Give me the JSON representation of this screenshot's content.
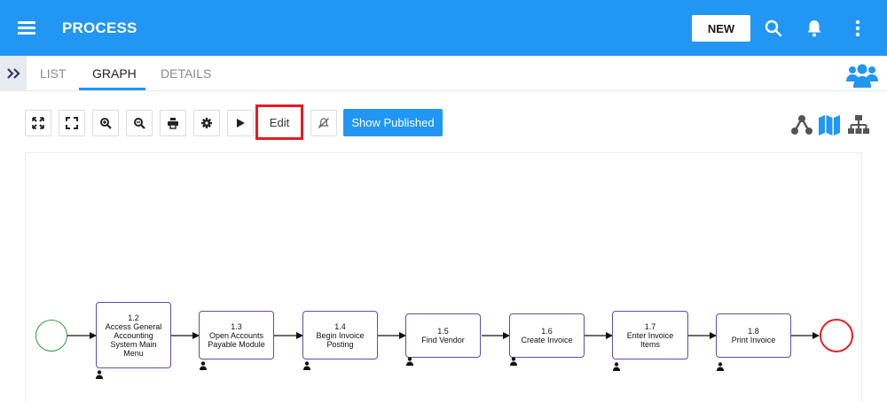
{
  "header": {
    "title": "PROCESS",
    "new_label": "NEW",
    "icons": [
      "menu-icon",
      "search-icon",
      "bell-icon",
      "more-vertical-icon"
    ],
    "bar_color": "#2196f3"
  },
  "tabs": [
    {
      "label": "LIST",
      "active": false
    },
    {
      "label": "GRAPH",
      "active": true
    },
    {
      "label": "DETAILS",
      "active": false
    }
  ],
  "toolbar": {
    "tools": [
      "fit-screen-icon",
      "fullscreen-icon",
      "zoom-in-icon",
      "zoom-out-icon",
      "print-icon",
      "gear-icon",
      "play-icon"
    ],
    "edit_label": "Edit",
    "show_published_label": "Show Published",
    "highlight_color": "#e51c23",
    "view_icons": [
      "flow-view-icon",
      "map-view-icon",
      "hierarchy-view-icon"
    ]
  },
  "graph": {
    "start_color": "#2e9b3a",
    "end_color": "#e51c23",
    "nodes": [
      {
        "num": "1.2",
        "text": "Access General\nAccounting\nSystem Main\nMenu"
      },
      {
        "num": "1.3",
        "text": "Open Accounts\nPayable Module"
      },
      {
        "num": "1.4",
        "text": "Begin Invoice\nPosting"
      },
      {
        "num": "1.5",
        "text": "Find Vendor"
      },
      {
        "num": "1.6",
        "text": "Create Invoice"
      },
      {
        "num": "1.7",
        "text": "Enter Invoice\nItems"
      },
      {
        "num": "1.8",
        "text": "Print Invoice"
      }
    ]
  }
}
